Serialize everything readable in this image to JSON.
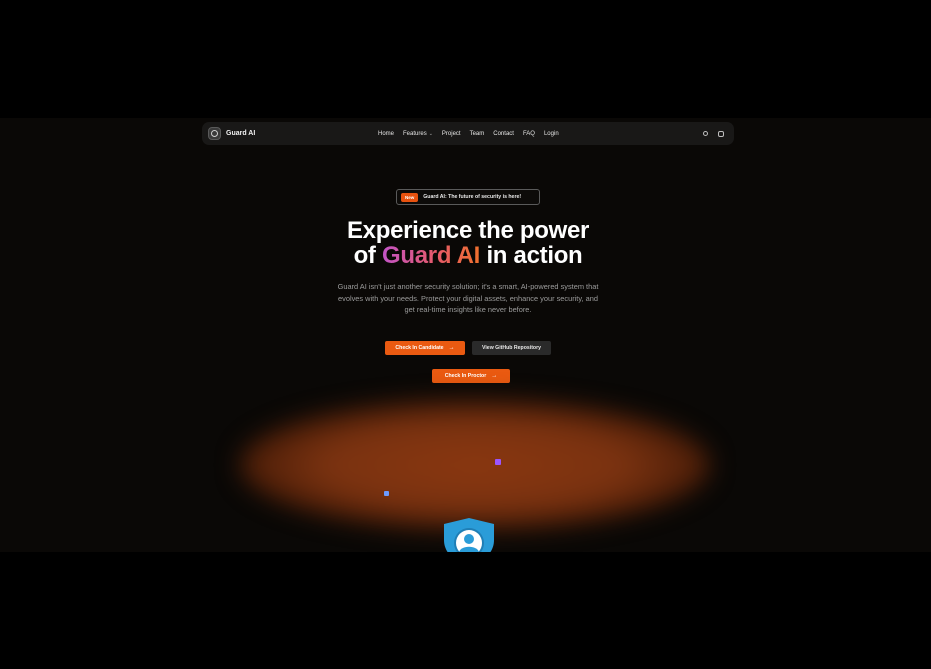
{
  "navbar": {
    "brand": "Guard AI",
    "links": [
      "Home",
      "Features",
      "Project",
      "Team",
      "Contact",
      "FAQ",
      "Login"
    ]
  },
  "announcement": {
    "badge": "New",
    "text": "Guard AI: The future of security is here!"
  },
  "hero": {
    "title_line1": "Experience the power",
    "title_of": "of",
    "title_highlight": "Guard AI",
    "title_end": "in action",
    "subtitle": "Guard AI isn't just another security solution; it's a smart, AI-powered system that evolves with your needs. Protect your digital assets, enhance your security, and get real-time insights like never before."
  },
  "buttons": {
    "candidate": "Check In Candidate",
    "github": "View GitHub Repository",
    "proctor": "Check In Proctor",
    "arrow": "→"
  },
  "colors": {
    "accent": "#ea5a11",
    "gradient_start": "#c254c7",
    "gradient_end": "#f0702e",
    "shield": "#2a9cd8"
  },
  "icons": [
    "logo-icon",
    "chevron-down-icon",
    "theme-toggle-icon",
    "github-icon",
    "arrow-right-icon",
    "shield-user-icon"
  ]
}
